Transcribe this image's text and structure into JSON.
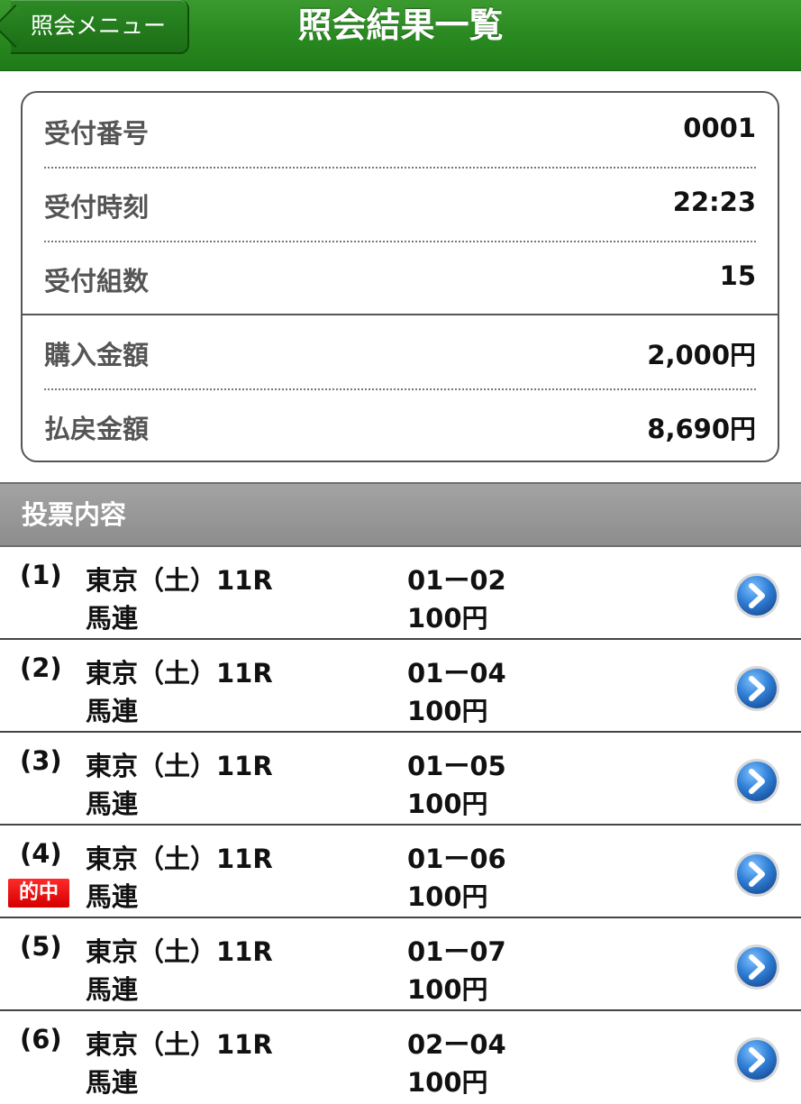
{
  "header": {
    "back_label": "照会メニュー",
    "title": "照会結果一覧"
  },
  "summary": {
    "rows": [
      {
        "label": "受付番号",
        "value": "0001"
      },
      {
        "label": "受付時刻",
        "value": "22:23"
      },
      {
        "label": "受付組数",
        "value": "15"
      },
      {
        "label": "購入金額",
        "value": "2,000円"
      },
      {
        "label": "払戻金額",
        "value": "8,690円"
      }
    ]
  },
  "section": {
    "title": "投票内容"
  },
  "bets": [
    {
      "num": "(1)",
      "race": "東京（土）11R",
      "type": "馬連",
      "combo": "01ー02",
      "amount": "100円",
      "hit": ""
    },
    {
      "num": "(2)",
      "race": "東京（土）11R",
      "type": "馬連",
      "combo": "01ー04",
      "amount": "100円",
      "hit": ""
    },
    {
      "num": "(3)",
      "race": "東京（土）11R",
      "type": "馬連",
      "combo": "01ー05",
      "amount": "100円",
      "hit": ""
    },
    {
      "num": "(4)",
      "race": "東京（土）11R",
      "type": "馬連",
      "combo": "01ー06",
      "amount": "100円",
      "hit": "的中"
    },
    {
      "num": "(5)",
      "race": "東京（土）11R",
      "type": "馬連",
      "combo": "01ー07",
      "amount": "100円",
      "hit": ""
    },
    {
      "num": "(6)",
      "race": "東京（土）11R",
      "type": "馬連",
      "combo": "02ー04",
      "amount": "100円",
      "hit": ""
    }
  ],
  "colors": {
    "header_green": "#2a8a21",
    "hit_red": "#e00000",
    "chevron_blue": "#2f7fd6",
    "section_gray": "#999999"
  },
  "icons": {
    "back": "chevron-left-icon",
    "row_action": "chevron-right-circle-icon"
  }
}
